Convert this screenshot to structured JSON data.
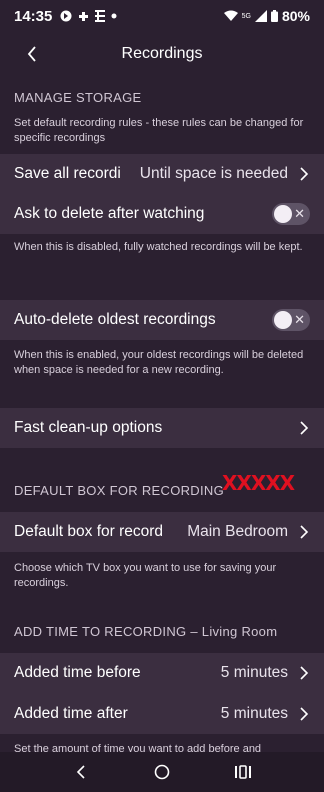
{
  "status_bar": {
    "time": "14:35",
    "battery": "80%",
    "network": "5G"
  },
  "app_bar": {
    "title": "Recordings",
    "back_icon": "chevron-left-icon"
  },
  "manage_storage": {
    "header": "MANAGE STORAGE",
    "description": "Set default recording rules - these rules can be changed for specific recordings",
    "save_all": {
      "label": "Save all recordi",
      "value": "Until space is needed"
    },
    "ask_delete": {
      "label": "Ask to delete after watching",
      "enabled": false
    },
    "ask_delete_note": "When this is disabled, fully watched recordings will be kept.",
    "auto_delete": {
      "label": "Auto-delete oldest recordings",
      "enabled": false
    },
    "auto_delete_note": "When this is enabled, your oldest recordings will be deleted when space is needed for a new recording.",
    "fast_cleanup": {
      "label": "Fast clean-up options"
    }
  },
  "default_box": {
    "header": "DEFAULT BOX FOR RECORDING",
    "redaction": "XXXXX",
    "row": {
      "label": "Default box for record",
      "value": "Main Bedroom"
    },
    "note": "Choose which TV box you want to use for saving your recordings."
  },
  "add_time": {
    "header": "ADD TIME TO RECORDING – Living Room",
    "before": {
      "label": "Added time before",
      "value": "5 minutes"
    },
    "after": {
      "label": "Added time after",
      "value": "5 minutes"
    },
    "note": "Set the amount of time you want to add before and"
  },
  "colors": {
    "background": "#2b2030",
    "row_background": "#3b2e40",
    "redaction": "#e01020"
  }
}
